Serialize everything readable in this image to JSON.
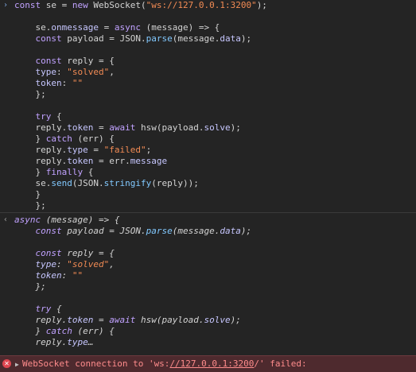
{
  "console": {
    "input_prefix": "›",
    "output_prefix": "‹",
    "input_code": [
      [
        {
          "t": "kw",
          "v": "const"
        },
        {
          "t": "id",
          "v": " se = "
        },
        {
          "t": "kw",
          "v": "new"
        },
        {
          "t": "id",
          "v": " WebSocket("
        },
        {
          "t": "str",
          "v": "\"ws://127.0.0.1:3200\""
        },
        {
          "t": "id",
          "v": ");"
        }
      ],
      [],
      [
        {
          "t": "id",
          "v": "    se."
        },
        {
          "t": "prop",
          "v": "onmessage"
        },
        {
          "t": "id",
          "v": " = "
        },
        {
          "t": "kw",
          "v": "async"
        },
        {
          "t": "id",
          "v": " (message) => {"
        }
      ],
      [
        {
          "t": "id",
          "v": "    "
        },
        {
          "t": "kw",
          "v": "const"
        },
        {
          "t": "id",
          "v": " payload = JSON."
        },
        {
          "t": "fn2",
          "v": "parse"
        },
        {
          "t": "id",
          "v": "(message."
        },
        {
          "t": "prop",
          "v": "data"
        },
        {
          "t": "id",
          "v": ");"
        }
      ],
      [],
      [
        {
          "t": "id",
          "v": "    "
        },
        {
          "t": "kw",
          "v": "const"
        },
        {
          "t": "id",
          "v": " reply = {"
        }
      ],
      [
        {
          "t": "id",
          "v": "    "
        },
        {
          "t": "prop",
          "v": "type"
        },
        {
          "t": "id",
          "v": ": "
        },
        {
          "t": "str",
          "v": "\"solved\""
        },
        {
          "t": "id",
          "v": ","
        }
      ],
      [
        {
          "t": "id",
          "v": "    "
        },
        {
          "t": "prop",
          "v": "token"
        },
        {
          "t": "id",
          "v": ": "
        },
        {
          "t": "str",
          "v": "\"\""
        }
      ],
      [
        {
          "t": "id",
          "v": "    };"
        }
      ],
      [],
      [
        {
          "t": "id",
          "v": "    "
        },
        {
          "t": "kw",
          "v": "try"
        },
        {
          "t": "id",
          "v": " {"
        }
      ],
      [
        {
          "t": "id",
          "v": "    reply."
        },
        {
          "t": "prop",
          "v": "token"
        },
        {
          "t": "id",
          "v": " = "
        },
        {
          "t": "kw",
          "v": "await"
        },
        {
          "t": "id",
          "v": " hsw(payload."
        },
        {
          "t": "prop",
          "v": "solve"
        },
        {
          "t": "id",
          "v": ");"
        }
      ],
      [
        {
          "t": "id",
          "v": "    } "
        },
        {
          "t": "kw",
          "v": "catch"
        },
        {
          "t": "id",
          "v": " (err) {"
        }
      ],
      [
        {
          "t": "id",
          "v": "    reply."
        },
        {
          "t": "prop",
          "v": "type"
        },
        {
          "t": "id",
          "v": " = "
        },
        {
          "t": "str",
          "v": "\"failed\""
        },
        {
          "t": "id",
          "v": ";"
        }
      ],
      [
        {
          "t": "id",
          "v": "    reply."
        },
        {
          "t": "prop",
          "v": "token"
        },
        {
          "t": "id",
          "v": " = err."
        },
        {
          "t": "prop",
          "v": "message"
        }
      ],
      [
        {
          "t": "id",
          "v": "    } "
        },
        {
          "t": "kw",
          "v": "finally"
        },
        {
          "t": "id",
          "v": " {"
        }
      ],
      [
        {
          "t": "id",
          "v": "    se."
        },
        {
          "t": "fn2",
          "v": "send"
        },
        {
          "t": "id",
          "v": "(JSON."
        },
        {
          "t": "fn2",
          "v": "stringify"
        },
        {
          "t": "id",
          "v": "(reply));"
        }
      ],
      [
        {
          "t": "id",
          "v": "    }"
        }
      ],
      [
        {
          "t": "id",
          "v": "    };"
        }
      ]
    ],
    "result_code": [
      [
        {
          "t": "kw",
          "v": "async"
        },
        {
          "t": "id",
          "v": " (message) => {"
        }
      ],
      [
        {
          "t": "id",
          "v": "    "
        },
        {
          "t": "kw",
          "v": "const"
        },
        {
          "t": "id",
          "v": " payload = JSON."
        },
        {
          "t": "fn2",
          "v": "parse"
        },
        {
          "t": "id",
          "v": "(message."
        },
        {
          "t": "prop",
          "v": "data"
        },
        {
          "t": "id",
          "v": ");"
        }
      ],
      [],
      [
        {
          "t": "id",
          "v": "    "
        },
        {
          "t": "kw",
          "v": "const"
        },
        {
          "t": "id",
          "v": " reply = {"
        }
      ],
      [
        {
          "t": "id",
          "v": "    "
        },
        {
          "t": "prop",
          "v": "type"
        },
        {
          "t": "id",
          "v": ": "
        },
        {
          "t": "str",
          "v": "\"solved\""
        },
        {
          "t": "id",
          "v": ","
        }
      ],
      [
        {
          "t": "id",
          "v": "    "
        },
        {
          "t": "prop",
          "v": "token"
        },
        {
          "t": "id",
          "v": ": "
        },
        {
          "t": "str",
          "v": "\"\""
        }
      ],
      [
        {
          "t": "id",
          "v": "    };"
        }
      ],
      [],
      [
        {
          "t": "id",
          "v": "    "
        },
        {
          "t": "kw",
          "v": "try"
        },
        {
          "t": "id",
          "v": " {"
        }
      ],
      [
        {
          "t": "id",
          "v": "    reply."
        },
        {
          "t": "prop",
          "v": "token"
        },
        {
          "t": "id",
          "v": " = "
        },
        {
          "t": "kw",
          "v": "await"
        },
        {
          "t": "id",
          "v": " hsw(payload."
        },
        {
          "t": "prop",
          "v": "solve"
        },
        {
          "t": "id",
          "v": ");"
        }
      ],
      [
        {
          "t": "id",
          "v": "    } "
        },
        {
          "t": "kw",
          "v": "catch"
        },
        {
          "t": "id",
          "v": " (err) {"
        }
      ],
      [
        {
          "t": "id",
          "v": "    reply."
        },
        {
          "t": "prop",
          "v": "type"
        },
        {
          "t": "id",
          "v": "…"
        }
      ]
    ],
    "error": {
      "icon": "error-x-icon",
      "icon_glyph": "✕",
      "expand_glyph": "▶",
      "prefix": "WebSocket connection to 'ws:",
      "url": "//127.0.0.1:3200",
      "suffix": "/' failed:"
    }
  }
}
